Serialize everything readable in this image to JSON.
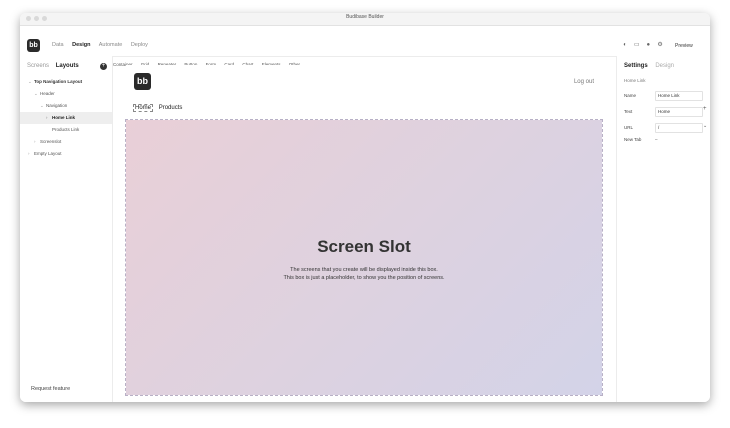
{
  "window": {
    "title": "Budibase Builder"
  },
  "topbar": {
    "logo": "bb",
    "nav": [
      "Data",
      "Design",
      "Automate",
      "Deploy"
    ],
    "preview": "Preview"
  },
  "left": {
    "tabs": [
      "Screens",
      "Layouts"
    ],
    "tree": [
      {
        "label": "Top Navigation Layout"
      },
      {
        "label": "Header"
      },
      {
        "label": "Navigation"
      },
      {
        "label": "Home Link"
      },
      {
        "label": "Products Link"
      },
      {
        "label": "Screenslot"
      },
      {
        "label": "Empty Layout"
      }
    ],
    "request_feature": "Request feature"
  },
  "toolbar": {
    "items": [
      "Container",
      "Grid",
      "Repeater",
      "Button",
      "Form",
      "Card",
      "Chart",
      "Elements",
      "Other"
    ]
  },
  "canvas": {
    "logo": "bb",
    "logout": "Log out",
    "nav": [
      "Home",
      "Products"
    ],
    "slot_title": "Screen Slot",
    "slot_text_1": "The screens that you create will be displayed inside this box.",
    "slot_text_2": "This box is just a placeholder, to show you the position of screens."
  },
  "right": {
    "tabs": [
      "Settings",
      "Design"
    ],
    "component_label": "Home Link",
    "props": [
      {
        "label": "Name",
        "value": "Home Link"
      },
      {
        "label": "Text",
        "value": "Home"
      },
      {
        "label": "URL",
        "value": "/"
      },
      {
        "label": "New Tab",
        "value": ""
      }
    ]
  }
}
